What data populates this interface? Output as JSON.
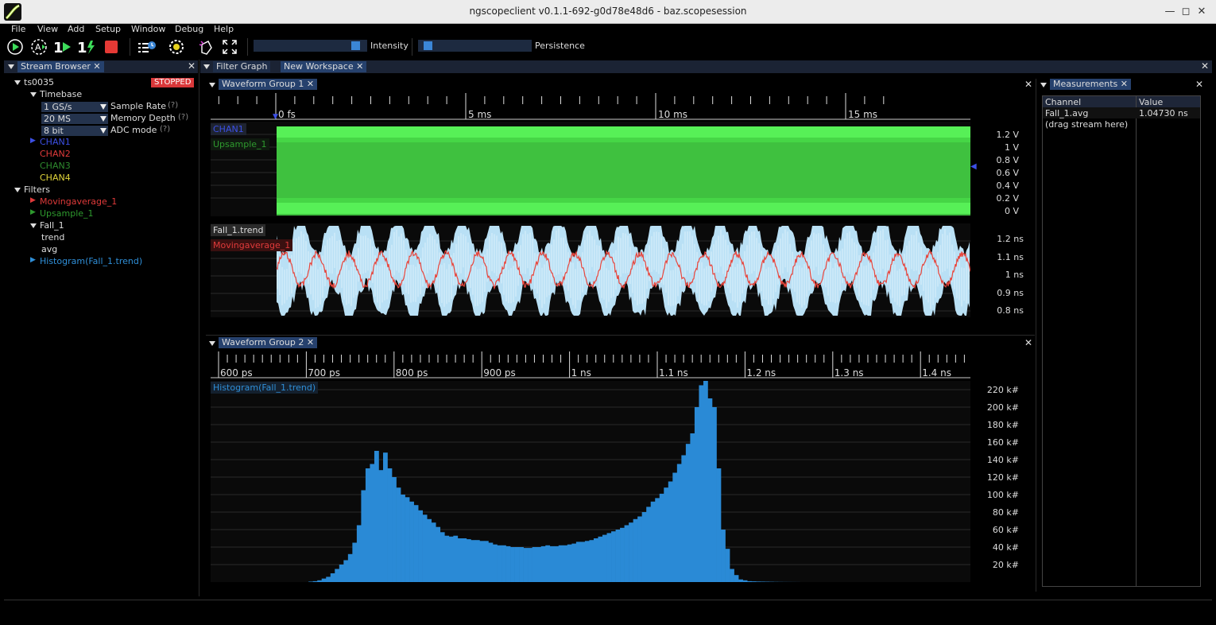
{
  "window": {
    "title": "ngscopeclient v0.1.1-692-g0d78e48d6  - baz.scopesession"
  },
  "menu": [
    "File",
    "View",
    "Add",
    "Setup",
    "Window",
    "Debug",
    "Help"
  ],
  "toolbar": {
    "intensity_label": "Intensity",
    "persistence_label": "Persistence",
    "intensity_level": 0.93,
    "persistence_level": 0.05,
    "icons": [
      "run-icon",
      "auto-trigger-icon",
      "single-trigger-icon",
      "force-trigger-icon",
      "stop-icon",
      "history-icon",
      "settings-icon",
      "clear-sweeps-icon",
      "fullscreen-icon"
    ]
  },
  "stream_browser": {
    "tab": "Stream Browser",
    "instrument": "ts0035",
    "status": "STOPPED",
    "timebase_label": "Timebase",
    "rows": [
      {
        "value": "1 GS/s",
        "label": "Sample Rate",
        "help": "(?)"
      },
      {
        "value": "20 MS",
        "label": "Memory Depth",
        "help": "(?)"
      },
      {
        "value": "8 bit",
        "label": "ADC mode",
        "help": "(?)"
      }
    ],
    "channels": [
      {
        "name": "CHAN1",
        "color": "#3c50e6"
      },
      {
        "name": "CHAN2",
        "color": "#e03a3a"
      },
      {
        "name": "CHAN3",
        "color": "#2e8b2e"
      },
      {
        "name": "CHAN4",
        "color": "#e0d43a"
      }
    ],
    "filters_label": "Filters",
    "filters": [
      {
        "name": "Movingaverage_1",
        "color": "#e03a3a"
      },
      {
        "name": "Upsample_1",
        "color": "#2e9a2e"
      },
      {
        "name": "Fall_1",
        "color": "#dddddd"
      }
    ],
    "fall_children": [
      "trend",
      "avg"
    ],
    "histogram_filter": {
      "name": "Histogram(Fall_1.trend)",
      "color": "#2f8fd8"
    }
  },
  "workspace_tabs": [
    "Filter Graph",
    "New Workspace"
  ],
  "group1": {
    "tab": "Waveform Group 1",
    "time_ticks": [
      "0 fs",
      "5 ms",
      "10 ms",
      "15 ms"
    ],
    "area1": {
      "labels": [
        "CHAN1",
        "Upsample_1"
      ],
      "y_ticks": [
        "1.2 V",
        "1 V",
        "0.8 V",
        "0.6 V",
        "0.4 V",
        "0.2 V",
        "0 V"
      ]
    },
    "area2": {
      "labels": [
        "Fall_1.trend",
        "Movingaverage_1"
      ],
      "y_ticks": [
        "1.2 ns",
        "1.1 ns",
        "1 ns",
        "0.9 ns",
        "0.8 ns"
      ]
    }
  },
  "group2": {
    "tab": "Waveform Group 2",
    "x_ticks": [
      "600 ps",
      "700 ps",
      "800 ps",
      "900 ps",
      "1 ns",
      "1.1 ns",
      "1.2 ns",
      "1.3 ns",
      "1.4 ns"
    ],
    "trace_label": "Histogram(Fall_1.trend)",
    "y_ticks": [
      "220 k#",
      "200 k#",
      "180 k#",
      "160 k#",
      "140 k#",
      "120 k#",
      "100 k#",
      "80 k#",
      "60 k#",
      "40 k#",
      "20 k#"
    ]
  },
  "measurements": {
    "tab": "Measurements",
    "columns": [
      "Channel",
      "Value"
    ],
    "rows": [
      {
        "channel": "Fall_1.avg",
        "value": "1.04730 ns"
      }
    ],
    "placeholder": "(drag stream here)"
  },
  "chart_data": {
    "type": "bar",
    "title": "Histogram(Fall_1.trend)",
    "xlabel": "",
    "ylabel": "",
    "xlim_ps": [
      545,
      1470
    ],
    "ylim": [
      0,
      230000
    ],
    "series": [
      {
        "color": "#2a8ad6",
        "bins_ps": [
          705,
          710,
          715,
          720,
          725,
          730,
          735,
          740,
          745,
          750,
          755,
          760,
          765,
          770,
          775,
          780,
          785,
          790,
          795,
          800,
          805,
          810,
          815,
          820,
          825,
          830,
          835,
          840,
          845,
          850,
          855,
          860,
          865,
          870,
          875,
          880,
          885,
          890,
          895,
          900,
          905,
          910,
          915,
          920,
          925,
          930,
          935,
          940,
          945,
          950,
          955,
          960,
          965,
          970,
          975,
          980,
          985,
          990,
          995,
          1000,
          1005,
          1010,
          1015,
          1020,
          1025,
          1030,
          1035,
          1040,
          1045,
          1050,
          1055,
          1060,
          1065,
          1070,
          1075,
          1080,
          1085,
          1090,
          1095,
          1100,
          1105,
          1110,
          1115,
          1120,
          1125,
          1130,
          1135,
          1140,
          1145,
          1150,
          1155,
          1160,
          1165,
          1170,
          1175,
          1180,
          1185,
          1190,
          1195,
          1200,
          1205,
          1210,
          1215,
          1220,
          1225,
          1230,
          1235,
          1240,
          1245,
          1250,
          1255,
          1260
        ],
        "values": [
          500,
          1000,
          2000,
          4000,
          6000,
          10000,
          15000,
          20000,
          25000,
          32000,
          45000,
          65000,
          105000,
          130000,
          135000,
          150000,
          128000,
          148000,
          130000,
          120000,
          108000,
          100000,
          97000,
          92000,
          88000,
          82000,
          77000,
          72000,
          68000,
          63000,
          57000,
          53000,
          52000,
          53000,
          50000,
          50000,
          49000,
          48000,
          48000,
          47000,
          47000,
          45000,
          43000,
          42000,
          42000,
          41000,
          40000,
          40000,
          40000,
          39000,
          39000,
          40000,
          40000,
          41000,
          42000,
          41000,
          41000,
          42000,
          42000,
          43000,
          44000,
          46000,
          46000,
          47000,
          48000,
          50000,
          52000,
          54000,
          56000,
          58000,
          60000,
          62000,
          65000,
          68000,
          72000,
          75000,
          80000,
          86000,
          92000,
          96000,
          101000,
          108000,
          115000,
          125000,
          135000,
          145000,
          158000,
          170000,
          200000,
          225000,
          230000,
          210000,
          200000,
          130000,
          60000,
          38000,
          15000,
          8000,
          3000,
          2000,
          1000,
          800,
          600,
          500,
          400,
          300,
          200,
          150,
          100,
          80,
          60,
          40
        ]
      }
    ]
  }
}
